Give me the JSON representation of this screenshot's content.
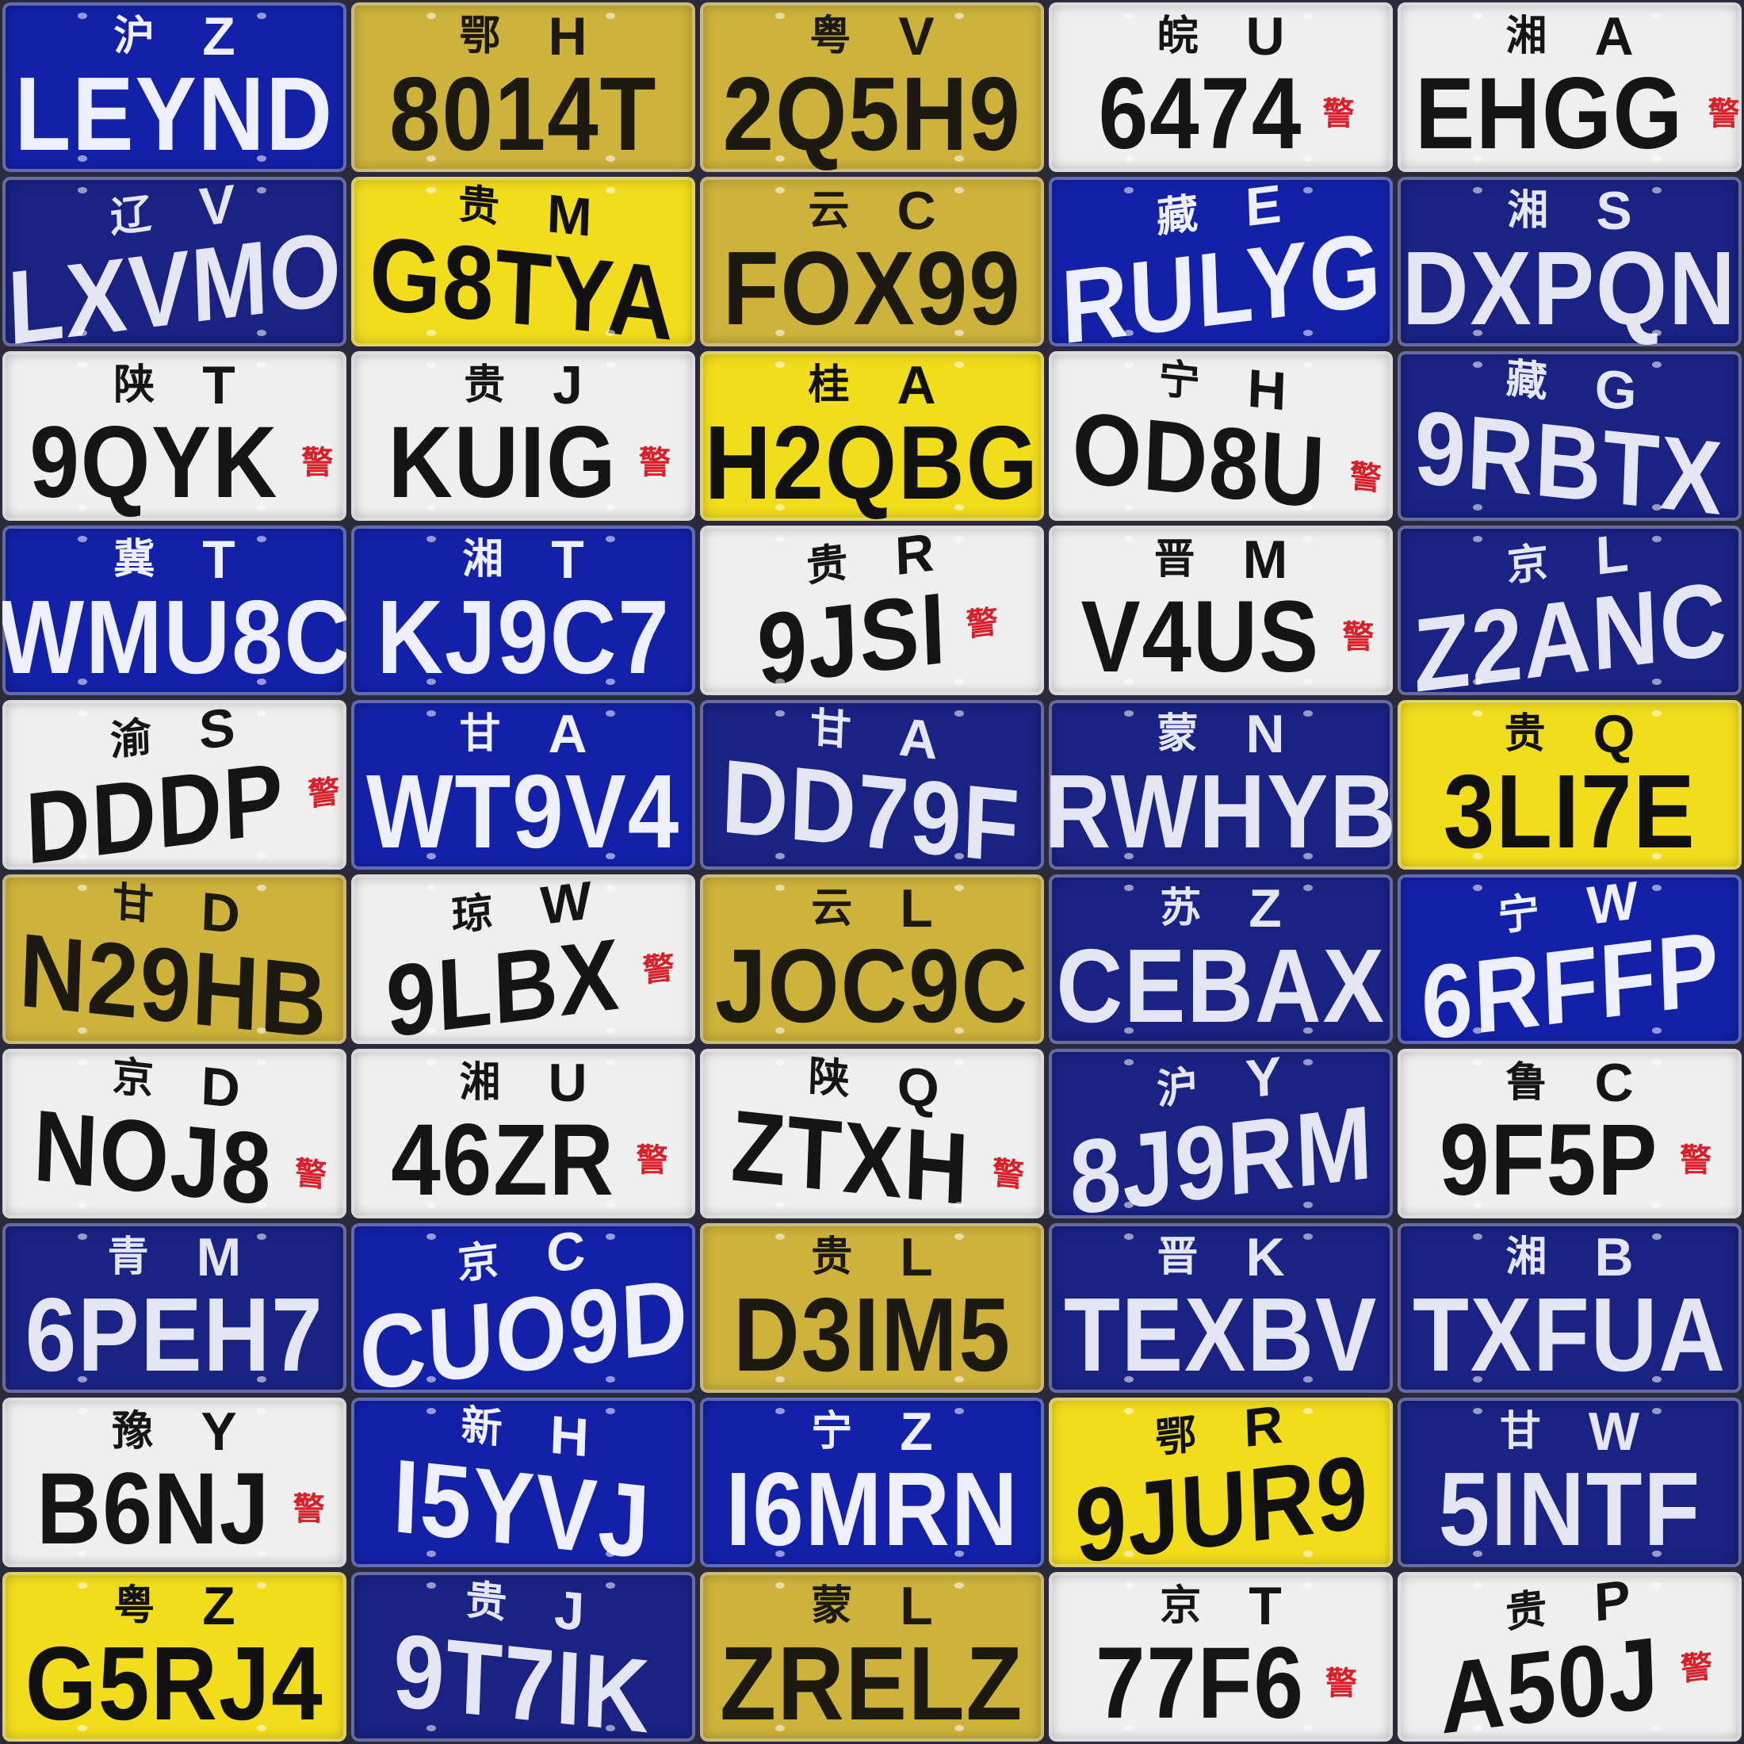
{
  "image": {
    "columns": 5,
    "rows": 10
  },
  "plates": [
    {
      "province": "沪",
      "city": "Z",
      "number": "LEYND",
      "bg": "blue",
      "police": ""
    },
    {
      "province": "鄂",
      "city": "H",
      "number": "8014T",
      "bg": "gold",
      "police": ""
    },
    {
      "province": "粤",
      "city": "V",
      "number": "2Q5H9",
      "bg": "gold",
      "police": ""
    },
    {
      "province": "皖",
      "city": "U",
      "number": "6474",
      "bg": "white",
      "police": "警"
    },
    {
      "province": "湘",
      "city": "A",
      "number": "EHGG",
      "bg": "white",
      "police": "警"
    },
    {
      "province": "辽",
      "city": "V",
      "number": "LXVMO",
      "bg": "navy",
      "police": "",
      "tilt": "l"
    },
    {
      "province": "贵",
      "city": "M",
      "number": "G8TYA",
      "bg": "yellow",
      "police": "",
      "tilt": "r"
    },
    {
      "province": "云",
      "city": "C",
      "number": "FOX99",
      "bg": "gold",
      "police": ""
    },
    {
      "province": "藏",
      "city": "E",
      "number": "RULYG",
      "bg": "blue",
      "police": "",
      "tilt": "l"
    },
    {
      "province": "湘",
      "city": "S",
      "number": "DXPQN",
      "bg": "navy",
      "police": ""
    },
    {
      "province": "陕",
      "city": "T",
      "number": "9QYK",
      "bg": "white",
      "police": "警"
    },
    {
      "province": "贵",
      "city": "J",
      "number": "KUIG",
      "bg": "white",
      "police": "警"
    },
    {
      "province": "桂",
      "city": "A",
      "number": "H2QBG",
      "bg": "yellow",
      "police": ""
    },
    {
      "province": "宁",
      "city": "H",
      "number": "OD8U",
      "bg": "white",
      "police": "警",
      "tilt": "r"
    },
    {
      "province": "藏",
      "city": "G",
      "number": "9RBTX",
      "bg": "navy",
      "police": "",
      "tilt": "r"
    },
    {
      "province": "冀",
      "city": "T",
      "number": "WMU8C",
      "bg": "blue",
      "police": ""
    },
    {
      "province": "湘",
      "city": "T",
      "number": "KJ9C7",
      "bg": "blue",
      "police": ""
    },
    {
      "province": "贵",
      "city": "R",
      "number": "9JSI",
      "bg": "white",
      "police": "警",
      "tilt": "l"
    },
    {
      "province": "晋",
      "city": "M",
      "number": "V4US",
      "bg": "white",
      "police": "警"
    },
    {
      "province": "京",
      "city": "L",
      "number": "Z2ANC",
      "bg": "navy",
      "police": "",
      "tilt": "l"
    },
    {
      "province": "渝",
      "city": "S",
      "number": "DDDP",
      "bg": "white",
      "police": "警",
      "tilt": "l"
    },
    {
      "province": "甘",
      "city": "A",
      "number": "WT9V4",
      "bg": "blue",
      "police": ""
    },
    {
      "province": "甘",
      "city": "A",
      "number": "DD79F",
      "bg": "navy",
      "police": "",
      "tilt": "r"
    },
    {
      "province": "蒙",
      "city": "N",
      "number": "RWHYB",
      "bg": "navy",
      "police": ""
    },
    {
      "province": "贵",
      "city": "Q",
      "number": "3LI7E",
      "bg": "yellow",
      "police": ""
    },
    {
      "province": "甘",
      "city": "D",
      "number": "N29HB",
      "bg": "gold",
      "police": "",
      "tilt": "r"
    },
    {
      "province": "琼",
      "city": "W",
      "number": "9LBX",
      "bg": "white",
      "police": "警",
      "tilt": "l"
    },
    {
      "province": "云",
      "city": "L",
      "number": "JOC9C",
      "bg": "gold",
      "police": ""
    },
    {
      "province": "苏",
      "city": "Z",
      "number": "CEBAX",
      "bg": "navy",
      "police": ""
    },
    {
      "province": "宁",
      "city": "W",
      "number": "6RFFP",
      "bg": "blue",
      "police": "",
      "tilt": "l"
    },
    {
      "province": "京",
      "city": "D",
      "number": "NOJ8",
      "bg": "white",
      "police": "警",
      "tilt": "r"
    },
    {
      "province": "湘",
      "city": "U",
      "number": "46ZR",
      "bg": "white",
      "police": "警"
    },
    {
      "province": "陕",
      "city": "Q",
      "number": "ZTXH",
      "bg": "white",
      "police": "警",
      "tilt": "r"
    },
    {
      "province": "沪",
      "city": "Y",
      "number": "8J9RM",
      "bg": "navy",
      "police": "",
      "tilt": "l"
    },
    {
      "province": "鲁",
      "city": "C",
      "number": "9F5P",
      "bg": "white",
      "police": "警"
    },
    {
      "province": "青",
      "city": "M",
      "number": "6PEH7",
      "bg": "navy",
      "police": ""
    },
    {
      "province": "京",
      "city": "C",
      "number": "CUO9D",
      "bg": "blue",
      "police": "",
      "tilt": "l"
    },
    {
      "province": "贵",
      "city": "L",
      "number": "D3IM5",
      "bg": "gold",
      "police": ""
    },
    {
      "province": "晋",
      "city": "K",
      "number": "TEXBV",
      "bg": "navy",
      "police": ""
    },
    {
      "province": "湘",
      "city": "B",
      "number": "TXFUA",
      "bg": "navy",
      "police": ""
    },
    {
      "province": "豫",
      "city": "Y",
      "number": "B6NJ",
      "bg": "white",
      "police": "警"
    },
    {
      "province": "新",
      "city": "H",
      "number": "I5YVJ",
      "bg": "blue",
      "police": "",
      "tilt": "r"
    },
    {
      "province": "宁",
      "city": "Z",
      "number": "I6MRN",
      "bg": "blue",
      "police": ""
    },
    {
      "province": "鄂",
      "city": "R",
      "number": "9JUR9",
      "bg": "yellow",
      "police": "",
      "tilt": "l"
    },
    {
      "province": "甘",
      "city": "W",
      "number": "5INTF",
      "bg": "navy",
      "police": ""
    },
    {
      "province": "粤",
      "city": "Z",
      "number": "G5RJ4",
      "bg": "yellow",
      "police": ""
    },
    {
      "province": "贵",
      "city": "J",
      "number": "9T7IK",
      "bg": "navy",
      "police": "",
      "tilt": "r"
    },
    {
      "province": "蒙",
      "city": "L",
      "number": "ZRELZ",
      "bg": "gold",
      "police": ""
    },
    {
      "province": "京",
      "city": "T",
      "number": "77F6",
      "bg": "white",
      "police": "警"
    },
    {
      "province": "贵",
      "city": "P",
      "number": "A50J",
      "bg": "white",
      "police": "警",
      "tilt": "l"
    }
  ]
}
